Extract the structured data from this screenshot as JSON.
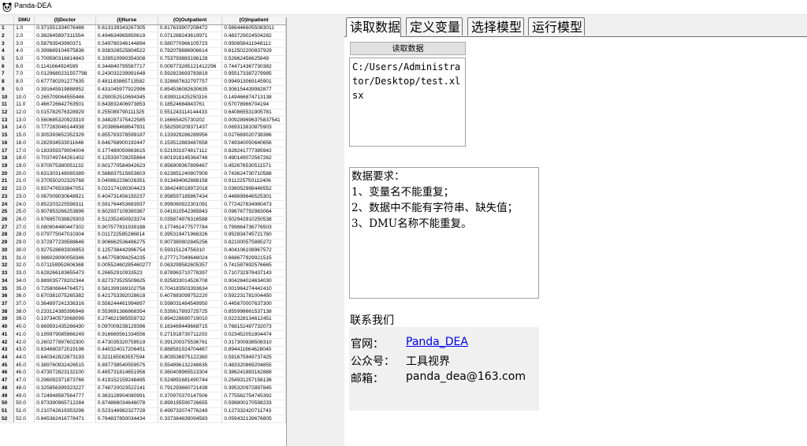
{
  "window": {
    "title": "Panda-DEA",
    "icon": "panda-icon"
  },
  "table": {
    "columns": [
      "",
      "DMU",
      "(I)Doctor",
      "(I)Nurse",
      "(O)Outpatient",
      "(O)Inpatient"
    ],
    "rows": [
      [
        "1",
        "1.0",
        "0.371551334076486",
        "0.613139343267305",
        "0.817633907208472",
        "0.5664466055083011"
      ],
      [
        "2",
        "2.0",
        "0.382645897311554",
        "0.494634965850619",
        "0.071288243619971",
        "0.483729024504282"
      ],
      [
        "3",
        "3.0",
        "0.58793543990371",
        "0.549780346144894",
        "0.580770966105723",
        "0.950858411948112"
      ],
      [
        "4",
        "4.0",
        "0.399689104975836",
        "0.938326525804522",
        "0.782078886906614",
        "0.812502200837929"
      ],
      [
        "5",
        "5.0",
        "0.709590316814843",
        "0.339510990354308",
        "0.753793883196128",
        "0.52662456625849"
      ],
      [
        "6",
        "6.0",
        "0.1141664924599",
        "0.344840795587717",
        "0.009773285121412296",
        "0.744714367730382"
      ],
      [
        "7",
        "7.0",
        "0.0129680231557798",
        "0.243032239991648",
        "0.592823693783819",
        "0.955173387279985"
      ],
      [
        "8",
        "8.0",
        "0.677780291277635",
        "0.481183865713582",
        "0.328687632797757",
        "0.994913069145901"
      ],
      [
        "9",
        "9.0",
        "0.391645919888952",
        "0.431045977922996",
        "0.854536082630635",
        "0.306154439982877"
      ],
      [
        "10",
        "10.0",
        "0.265709064555446",
        "0.290052510694345",
        "0.839911425250316",
        "0.149466874713138"
      ],
      [
        "11",
        "11.0",
        "0.466726642763501",
        "0.643832406973853",
        "0.18524684843761",
        "0.57078966704194"
      ],
      [
        "12",
        "12.0",
        "0.015782576328929",
        "0.255089790111325",
        "0.551243114144433",
        "0.640865531905781"
      ],
      [
        "13",
        "13.0",
        "0.560685320923319",
        "0.348287375422585",
        "0.16665425730202",
        "0.009289696375837541"
      ],
      [
        "14",
        "14.0",
        "0.777283046144938",
        "0.203866468647931",
        "0.582590209371437",
        "0.069313810875903"
      ],
      [
        "15",
        "15.0",
        "0.305393652352329",
        "0.855783378599187",
        "0.133929286289956",
        "0.027669020738386"
      ],
      [
        "16",
        "16.0",
        "0.282934533011646",
        "0.646768900192447",
        "0.153512883487658",
        "0.749340050640656"
      ],
      [
        "17",
        "17.0",
        "0.183359379004004",
        "0.177480050863615",
        "0.521931974817112",
        "0.828241777385942"
      ],
      [
        "18",
        "18.0",
        "0.703749744261402",
        "0.125330728255864",
        "0.601918145364748",
        "0.490149072567262"
      ],
      [
        "19",
        "19.0",
        "0.970075380051132",
        "0.601770584942623",
        "0.856909367899467",
        "0.452676530511571"
      ],
      [
        "20",
        "20.0",
        "0.631303148065389",
        "0.586837515653603",
        "0.623851240807909",
        "0.743624730710588"
      ],
      [
        "21",
        "21.0",
        "0.370550202329768",
        "0.040862236026351",
        "0.913484062888158",
        "0.911225750112406"
      ],
      [
        "22",
        "22.0",
        "0.937476533847051",
        "0.022174190304423",
        "0.384249018972018",
        "0.036052998446552"
      ],
      [
        "23",
        "23.0",
        "0.067009030648921",
        "0.404731456150237",
        "0.958597185867434",
        "0.448699646525301"
      ],
      [
        "24",
        "24.0",
        "0.852203225598311",
        "0.591764453683937",
        "0.999060922301091",
        "0.772427634980473"
      ],
      [
        "25",
        "25.0",
        "0.907853266253896",
        "0.602937109380367",
        "0.041810542365843",
        "0.096767792983064"
      ],
      [
        "26",
        "26.0",
        "0.976957038829303",
        "0.512352450923374",
        "0.035874976316588",
        "0.502942910250538"
      ],
      [
        "27",
        "27.0",
        "0.080904480447302",
        "0.907577831939188",
        "0.177461477577784",
        "0.799864736776503"
      ],
      [
        "28",
        "28.0",
        "0.079775047010304",
        "0.011722585286814",
        "0.395319471966326",
        "0.952834745721760"
      ],
      [
        "29",
        "29.0",
        "0.372977239588646",
        "0.906662536486275",
        "0.907380802845256",
        "0.821000575885272"
      ],
      [
        "30",
        "30.0",
        "0.927528693308953",
        "0.125738442996754",
        "0.59315124756310",
        "0.404106108967572"
      ],
      [
        "31",
        "31.0",
        "0.986028090058346",
        "0.467759094254235",
        "0.277717049648024",
        "0.668677929921515"
      ],
      [
        "32",
        "32.0",
        "0.071159952606368",
        "0.00552460285460277",
        "0.063299582605357",
        "0.741587692576665"
      ],
      [
        "33",
        "33.0",
        "0.628266183655473",
        "0.26652910933523",
        "0.878963710778397",
        "0.710732978437143"
      ],
      [
        "34",
        "34.0",
        "0.889035778202344",
        "0.827373525509625",
        "0.925833014526708",
        "0.904284024634030"
      ],
      [
        "35",
        "35.0",
        "0.725806644764571",
        "0.581399169102756",
        "0.704183503393634",
        "0.001964274442410"
      ],
      [
        "36",
        "36.0",
        "0.670381075265382",
        "0.421753392028618",
        "0.407883099752220",
        "0.592231781004450"
      ],
      [
        "37",
        "37.0",
        "0.364897241336316",
        "0.556244461994897",
        "0.598031484549950",
        "0.445670007637300"
      ],
      [
        "38",
        "38.0",
        "0.233124385396948",
        "0.553691386868354",
        "0.535617893725725",
        "0.855998661537138"
      ],
      [
        "39",
        "39.0",
        "0.197340573068099",
        "0.274621985559732",
        "0.894228690719010",
        "0.022328134612451"
      ],
      [
        "40",
        "40.0",
        "0.669591435266430",
        "0.097009238129396",
        "0.163469449668715",
        "0.768152497732073"
      ],
      [
        "41",
        "41.0",
        "0.199979085966249",
        "0.916660561334556",
        "0.271918730711203",
        "0.023452051804474"
      ],
      [
        "42",
        "42.0",
        "0.260277897602300",
        "0.473035320759519",
        "0.391200375536761",
        "0.317300838508310"
      ],
      [
        "43",
        "43.0",
        "0.834680372019196",
        "0.440324017206451",
        "0.888581924704467",
        "0.894411664628040"
      ],
      [
        "44",
        "44.0",
        "0.640342822673193",
        "0.321165063557594",
        "0.803536975122360",
        "0.591675949737425"
      ],
      [
        "45",
        "45.0",
        "0.389760932426515",
        "0.897738540559575",
        "0.554896132248635",
        "0.483320869204855"
      ],
      [
        "46",
        "46.0",
        "0.473072823132100",
        "0.465731814651956",
        "0.360409965513304",
        "0.386241883162888"
      ],
      [
        "47",
        "47.0",
        "0.296092371873766",
        "0.419152159248485",
        "0.524891681490744",
        "0.254931257156136"
      ],
      [
        "48",
        "48.0",
        "0.325856399323227",
        "0.748720023522141",
        "0.791293660721438",
        "0.395320972897845"
      ],
      [
        "49",
        "49.0",
        "0.724948587564777",
        "0.363128904080991",
        "0.370970370147506",
        "0.775562754745392"
      ],
      [
        "50",
        "50.0",
        "0.973390965712284",
        "0.874866034646078",
        "0.899195590726655",
        "0.598800170598233"
      ],
      [
        "51",
        "51.0",
        "0.210742619353296",
        "0.523146982327728",
        "0.499732074776249",
        "0.127332420711743"
      ],
      [
        "52",
        "52.0",
        "0.845362416778471",
        "0.764837850034434",
        "0.337384839094583",
        "0.059432139676805"
      ]
    ]
  },
  "tabs": [
    {
      "label": "读取数据",
      "active": true
    },
    {
      "label": "定义变量",
      "active": false
    },
    {
      "label": "选择模型",
      "active": false
    },
    {
      "label": "运行模型",
      "active": false
    }
  ],
  "read_panel": {
    "button_label": "读取数据",
    "file_path": "C:/Users/Administrator/Desktop/test.xlsx",
    "requirements": [
      "数据要求：",
      "1、变量名不能重复；",
      "2、数据中不能有字符串、缺失值；",
      "3、DMU名称不能重复。"
    ],
    "contact_heading": "联系我们",
    "contact": {
      "website_label": "官网：",
      "website_value": "Panda_DEA",
      "wechat_label": "公众号：",
      "wechat_value": "工具视界",
      "email_label": "邮箱：",
      "email_value": "panda_dea@163.com"
    }
  }
}
